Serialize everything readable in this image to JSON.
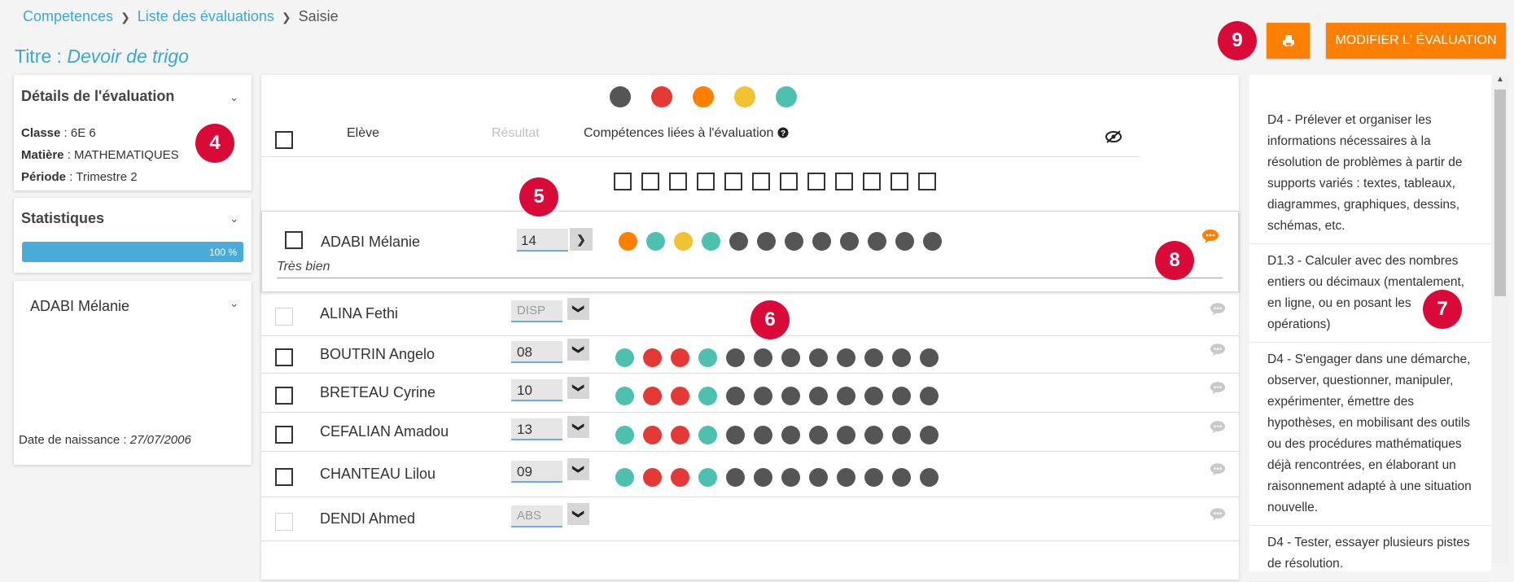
{
  "breadcrumb": {
    "items": [
      "Competences",
      "Liste des évaluations"
    ],
    "current": "Saisie"
  },
  "title": {
    "label": "Titre :",
    "value": "Devoir de trigo"
  },
  "actions": {
    "modify_label": "MODIFIER L' ÉVALUATION",
    "print_icon": "printer-icon"
  },
  "badges": [
    "4",
    "5",
    "6",
    "7",
    "8",
    "9"
  ],
  "details": {
    "header": "Détails de l'évaluation",
    "classe_label": "Classe",
    "classe": "6E 6",
    "matiere_label": "Matière",
    "matiere": "MATHEMATIQUES",
    "periode_label": "Période",
    "periode": "Trimestre 2"
  },
  "stats": {
    "header": "Statistiques",
    "progress_text": "100 %",
    "progress": 1.0
  },
  "student_card": {
    "name": "ADABI Mélanie",
    "birth_label": "Date de naissance :",
    "birth": "27/07/2006"
  },
  "colors": {
    "grey": "#555555",
    "red": "#e53935",
    "orange": "#ff8000",
    "yellow": "#f1c232",
    "teal": "#4dc0b0",
    "accent": "#3da7d4",
    "badge": "#d90a37"
  },
  "legend_colors": [
    "grey",
    "red",
    "orange",
    "yellow",
    "teal"
  ],
  "table": {
    "col_student": "Elève",
    "col_result": "Résultat",
    "col_skills": "Compétences liées à l'évaluation",
    "help_icon": "question-circle-icon",
    "visibility_icon": "eye-slash-icon",
    "skill_checkbox_count": 12
  },
  "selected": {
    "name": "ADABI Mélanie",
    "score": "14",
    "skills": [
      "orange",
      "teal",
      "yellow",
      "teal",
      "grey",
      "grey",
      "grey",
      "grey",
      "grey",
      "grey",
      "grey",
      "grey"
    ],
    "comment": "Très bien"
  },
  "students": [
    {
      "name": "ALINA Fethi",
      "score": "DISP",
      "disabled": true,
      "skills": []
    },
    {
      "name": "BOUTRIN Angelo",
      "score": "08",
      "disabled": false,
      "skills": [
        "teal",
        "red",
        "red",
        "teal",
        "grey",
        "grey",
        "grey",
        "grey",
        "grey",
        "grey",
        "grey",
        "grey"
      ]
    },
    {
      "name": "BRETEAU Cyrine",
      "score": "10",
      "disabled": false,
      "skills": [
        "teal",
        "red",
        "red",
        "teal",
        "grey",
        "grey",
        "grey",
        "grey",
        "grey",
        "grey",
        "grey",
        "grey"
      ]
    },
    {
      "name": "CEFALIAN Amadou",
      "score": "13",
      "disabled": false,
      "skills": [
        "teal",
        "red",
        "red",
        "teal",
        "grey",
        "grey",
        "grey",
        "grey",
        "grey",
        "grey",
        "grey",
        "grey"
      ]
    },
    {
      "name": "CHANTEAU Lilou",
      "score": "09",
      "disabled": false,
      "skills": [
        "teal",
        "red",
        "red",
        "teal",
        "grey",
        "grey",
        "grey",
        "grey",
        "grey",
        "grey",
        "grey",
        "grey"
      ]
    },
    {
      "name": "DENDI Ahmed",
      "score": "ABS",
      "disabled": true,
      "skills": []
    }
  ],
  "skills_panel": [
    "D4 - Prélever et organiser les informations nécessaires à la résolution de problèmes à partir de supports variés : textes, tableaux, diagrammes, graphiques, dessins, schémas, etc.",
    "D1.3 - Calculer avec des nombres entiers ou décimaux (mentalement, en ligne, ou en posant les opérations)",
    "D4 - S'engager dans une démarche, observer, questionner, manipuler, expérimenter, émettre des hypothèses, en mobilisant des outils ou des procédures mathématiques déjà rencontrées, en élaborant un raisonnement adapté à une situation nouvelle.",
    "D4 - Tester, essayer plusieurs pistes de résolution."
  ]
}
